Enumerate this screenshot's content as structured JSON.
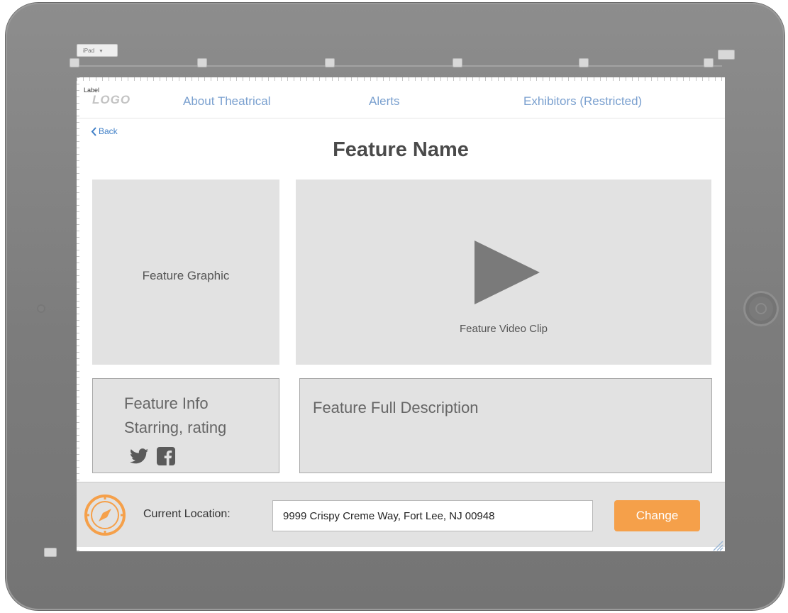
{
  "device": {
    "selector_label": "iPad"
  },
  "label_tag": "Label",
  "nav": {
    "logo": "LOGO",
    "links": [
      "About Theatrical",
      "Alerts",
      "Exhibitors (Restricted)"
    ]
  },
  "back": {
    "label": "Back"
  },
  "page_title": "Feature Name",
  "feature_graphic": {
    "label": "Feature Graphic"
  },
  "feature_video": {
    "label": "Feature Video Clip",
    "icon": "play-icon"
  },
  "feature_info": {
    "title": "Feature Info",
    "subtitle": "Starring, rating",
    "social_icons": [
      "twitter-icon",
      "facebook-icon"
    ]
  },
  "feature_description": {
    "title": "Feature Full Description"
  },
  "location": {
    "label": "Current Location:",
    "value": "9999 Crispy Creme Way, Fort Lee, NJ 00948",
    "button_label": "Change",
    "icon": "compass-icon"
  },
  "colors": {
    "link": "#7aa0cf",
    "back": "#3f7fc7",
    "accent": "#f5a04a",
    "panel": "#e2e2e2",
    "frame": "#7f7f7f"
  }
}
